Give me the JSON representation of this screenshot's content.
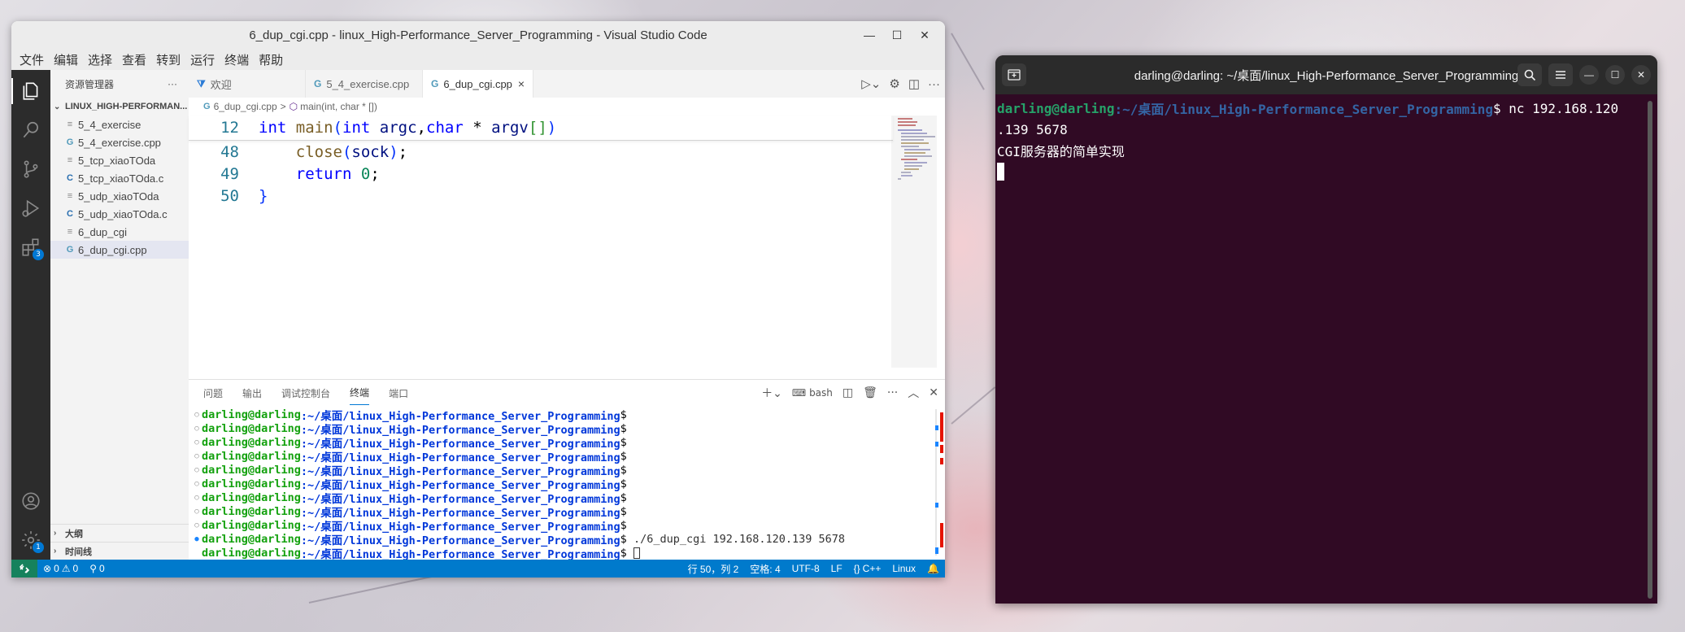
{
  "vscode": {
    "window_title": "6_dup_cgi.cpp - linux_High-Performance_Server_Programming - Visual Studio Code",
    "window_controls": {
      "minimize": "—",
      "maximize": "☐",
      "close": "✕"
    },
    "menu": [
      "文件",
      "编辑",
      "选择",
      "查看",
      "转到",
      "运行",
      "终端",
      "帮助"
    ],
    "explorer": {
      "header": "资源管理器",
      "more": "···",
      "folder": "LINUX_HIGH-PERFORMAN...",
      "files": [
        {
          "name": "5_4_exercise",
          "type": "none"
        },
        {
          "name": "5_4_exercise.cpp",
          "type": "cpp"
        },
        {
          "name": "5_tcp_xiaoTOda",
          "type": "none"
        },
        {
          "name": "5_tcp_xiaoTOda.c",
          "type": "c"
        },
        {
          "name": "5_udp_xiaoTOda",
          "type": "none"
        },
        {
          "name": "5_udp_xiaoTOda.c",
          "type": "c"
        },
        {
          "name": "6_dup_cgi",
          "type": "none"
        },
        {
          "name": "6_dup_cgi.cpp",
          "type": "cpp",
          "active": true
        }
      ],
      "outline": "大纲",
      "timeline": "时间线"
    },
    "activity_badges": {
      "extensions": "3",
      "settings": "1"
    },
    "tabs": [
      {
        "label": "欢迎",
        "icon": "vscode-icon"
      },
      {
        "label": "5_4_exercise.cpp",
        "icon": "cpp-icon"
      },
      {
        "label": "6_dup_cgi.cpp",
        "icon": "cpp-icon",
        "active": true,
        "close": "×"
      }
    ],
    "breadcrumb": {
      "file": "6_dup_cgi.cpp",
      "sep": ">",
      "symbol": "main(int, char * [])"
    },
    "code": {
      "sticky": {
        "num": "12",
        "text": "int main(int argc,char * argv[])"
      },
      "lines": [
        {
          "num": "48",
          "text": "    close(sock);"
        },
        {
          "num": "49",
          "text": "    return 0;"
        },
        {
          "num": "50",
          "text": "}"
        }
      ]
    },
    "panel": {
      "tabs": [
        "问题",
        "输出",
        "调试控制台",
        "终端",
        "端口"
      ],
      "active_tab": "终端",
      "shell": "bash",
      "prompt_user": "darling@darling",
      "prompt_path": ":~/桌面/linux_High-Performance_Server_Programming",
      "prompt_dollar": "$",
      "lines": [
        {
          "cmd": ""
        },
        {
          "cmd": ""
        },
        {
          "cmd": ""
        },
        {
          "cmd": ""
        },
        {
          "cmd": ""
        },
        {
          "cmd": ""
        },
        {
          "cmd": ""
        },
        {
          "cmd": ""
        },
        {
          "cmd": ""
        },
        {
          "cmd": " ./6_dup_cgi 192.168.120.139 5678",
          "running": true
        },
        {
          "cmd": " ",
          "cursor": true
        }
      ]
    },
    "status": {
      "errors": "0",
      "warnings": "0",
      "ports": "0",
      "position": "行 50，列 2",
      "spaces": "空格: 4",
      "encoding": "UTF-8",
      "eol": "LF",
      "language": "C++",
      "platform": "Linux"
    }
  },
  "terminal": {
    "title": "darling@darling: ~/桌面/linux_High-Performance_Server_Programming",
    "prompt_user": "darling@darling",
    "prompt_path": ":~/桌面/linux_High-Performance_Server_Programming",
    "prompt_dollar": "$",
    "command": " nc 192.168.120",
    "command_wrap": ".139 5678",
    "output": "CGI服务器的简单实现"
  },
  "colors": {
    "activitybar": "#2c2c2c",
    "statusbar": "#007acc",
    "terminal_bg": "#300a24",
    "prompt_green": "#26a269",
    "prompt_blue": "#3465a4"
  }
}
